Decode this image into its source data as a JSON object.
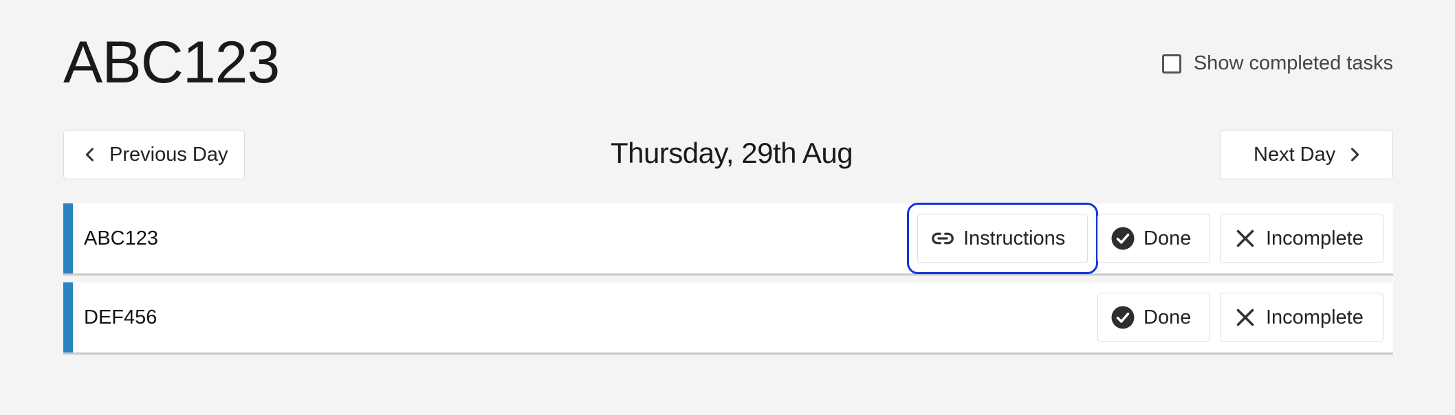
{
  "header": {
    "title": "ABC123",
    "show_completed_label": "Show completed tasks",
    "show_completed_checked": false
  },
  "day_nav": {
    "previous_label": "Previous Day",
    "next_label": "Next Day",
    "current_date": "Thursday, 29th Aug"
  },
  "tasks": [
    {
      "name": "ABC123",
      "instructions_label": "Instructions",
      "done_label": "Done",
      "incomplete_label": "Incomplete",
      "has_instructions": true,
      "instructions_focused": true
    },
    {
      "name": "DEF456",
      "done_label": "Done",
      "incomplete_label": "Incomplete",
      "has_instructions": false
    }
  ],
  "colors": {
    "background": "#f4f4f4",
    "task_accent": "#2b83c2",
    "focus_ring": "#1236d8"
  },
  "icons": {
    "previous": "chevron-left-icon",
    "next": "chevron-right-icon",
    "instructions": "link-icon",
    "done": "check-circle-icon",
    "incomplete": "x-icon",
    "checkbox": "checkbox-unchecked-icon"
  }
}
